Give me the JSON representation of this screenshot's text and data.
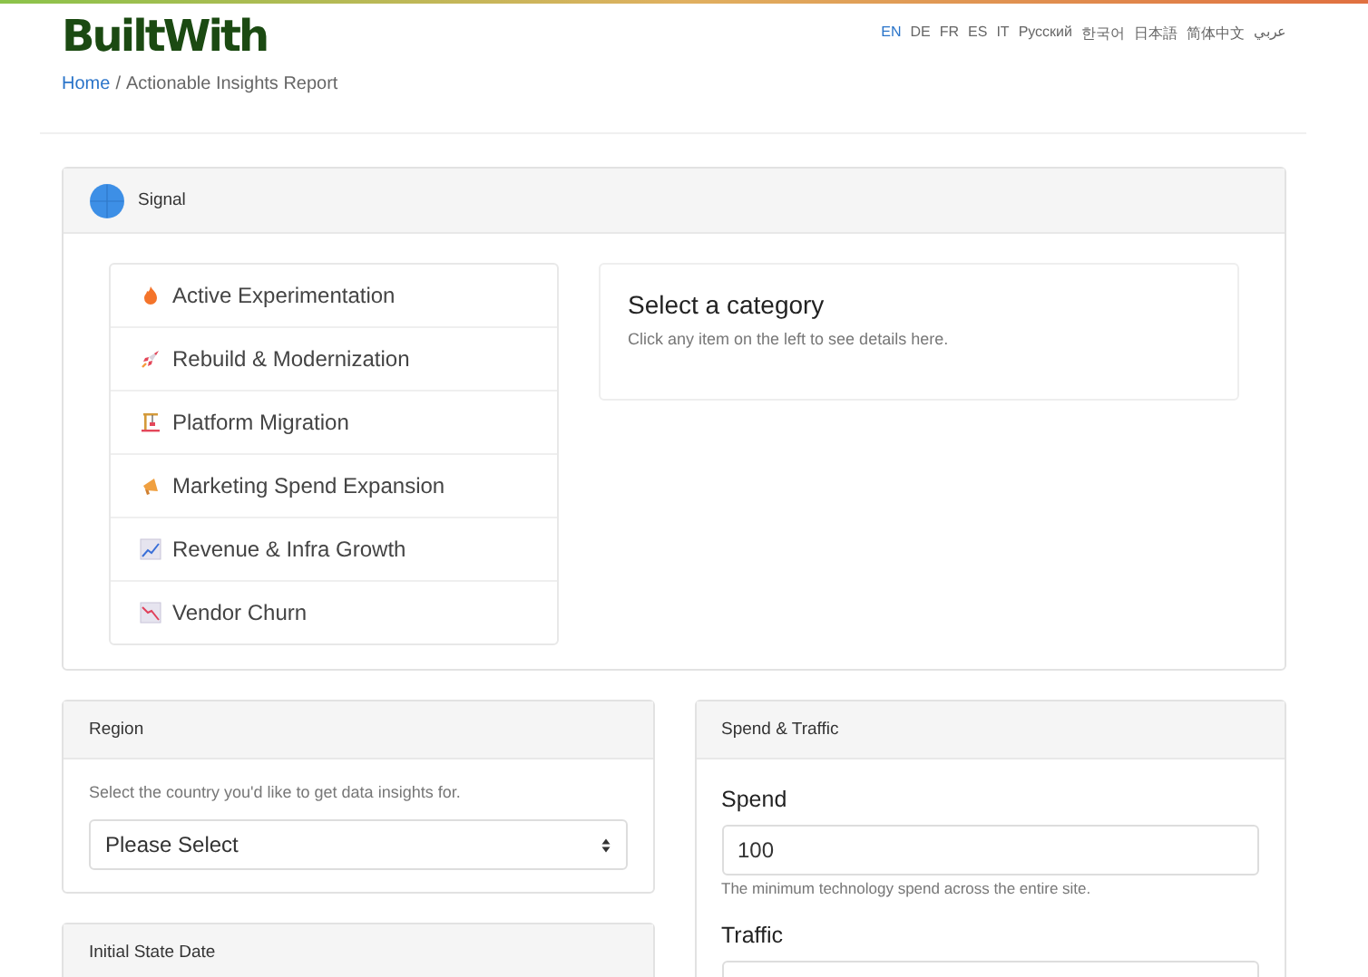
{
  "header": {
    "logo": "BuiltWith",
    "languages": [
      {
        "label": "EN",
        "selected": true
      },
      {
        "label": "DE",
        "selected": false
      },
      {
        "label": "FR",
        "selected": false
      },
      {
        "label": "ES",
        "selected": false
      },
      {
        "label": "IT",
        "selected": false
      },
      {
        "label": "Русский",
        "selected": false
      },
      {
        "label": "한국어",
        "selected": false
      },
      {
        "label": "日本語",
        "selected": false
      },
      {
        "label": "简体中文",
        "selected": false
      },
      {
        "label": "عربي",
        "selected": false
      }
    ]
  },
  "breadcrumb": {
    "home": "Home",
    "separator": "/",
    "current": "Actionable Insights Report"
  },
  "signal": {
    "title": "Signal",
    "items": [
      {
        "label": "Active Experimentation",
        "kind": "fire"
      },
      {
        "label": "Rebuild & Modernization",
        "kind": "rocket"
      },
      {
        "label": "Platform Migration",
        "kind": "crane"
      },
      {
        "label": "Marketing Spend Expansion",
        "kind": "megaphone"
      },
      {
        "label": "Revenue & Infra Growth",
        "kind": "chart-up"
      },
      {
        "label": "Vendor Churn",
        "kind": "chart-down"
      }
    ],
    "detail": {
      "title": "Select a category",
      "text": "Click any item on the left to see details here."
    }
  },
  "region": {
    "title": "Region",
    "text": "Select the country you'd like to get data insights for.",
    "select": "Please Select"
  },
  "initial_state": {
    "title": "Initial State Date"
  },
  "spend_traffic": {
    "title": "Spend & Traffic",
    "spend": {
      "label": "Spend",
      "value": "100",
      "help": "The minimum technology spend across the entire site."
    },
    "traffic": {
      "label": "Traffic"
    }
  }
}
